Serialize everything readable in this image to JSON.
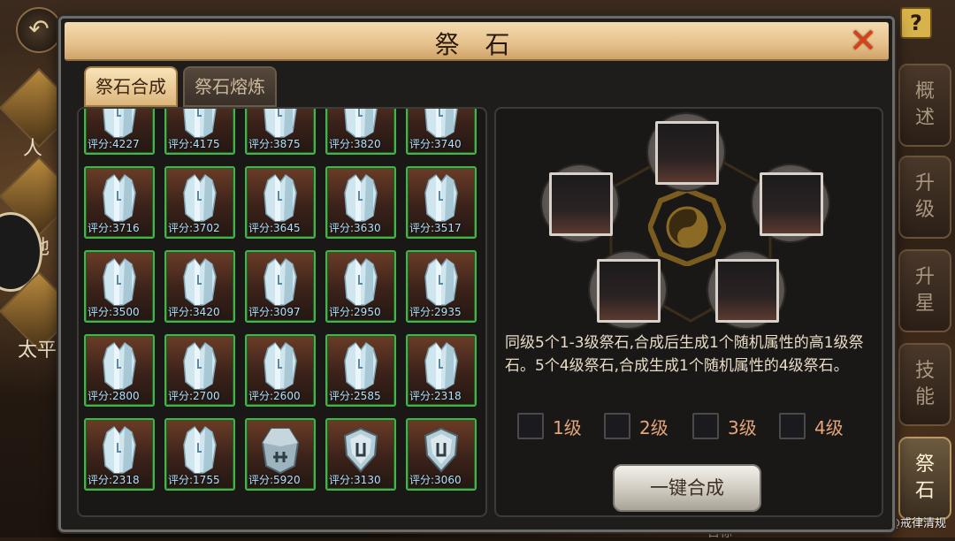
{
  "dialog": {
    "title": "祭 石",
    "close_symbol": "✕",
    "tabs": [
      {
        "label": "祭石合成",
        "active": true
      },
      {
        "label": "祭石熔炼",
        "active": false
      }
    ]
  },
  "inventory": {
    "rows": [
      [
        {
          "score": "评分:4227",
          "type": "crystal"
        },
        {
          "score": "评分:4175",
          "type": "crystal"
        },
        {
          "score": "评分:3875",
          "type": "crystal"
        },
        {
          "score": "评分:3820",
          "type": "crystal"
        },
        {
          "score": "评分:3740",
          "type": "crystal"
        }
      ],
      [
        {
          "score": "评分:3716",
          "type": "crystal"
        },
        {
          "score": "评分:3702",
          "type": "crystal"
        },
        {
          "score": "评分:3645",
          "type": "crystal"
        },
        {
          "score": "评分:3630",
          "type": "crystal"
        },
        {
          "score": "评分:3517",
          "type": "crystal"
        }
      ],
      [
        {
          "score": "评分:3500",
          "type": "crystal"
        },
        {
          "score": "评分:3420",
          "type": "crystal"
        },
        {
          "score": "评分:3097",
          "type": "crystal"
        },
        {
          "score": "评分:2950",
          "type": "crystal"
        },
        {
          "score": "评分:2935",
          "type": "crystal"
        }
      ],
      [
        {
          "score": "评分:2800",
          "type": "crystal"
        },
        {
          "score": "评分:2700",
          "type": "crystal"
        },
        {
          "score": "评分:2600",
          "type": "crystal"
        },
        {
          "score": "评分:2585",
          "type": "crystal"
        },
        {
          "score": "评分:2318",
          "type": "crystal"
        }
      ],
      [
        {
          "score": "评分:2318",
          "type": "crystal"
        },
        {
          "score": "评分:1755",
          "type": "crystal"
        },
        {
          "score": "评分:5920",
          "type": "stone"
        },
        {
          "score": "评分:3130",
          "type": "shield"
        },
        {
          "score": "评分:3060",
          "type": "shield"
        }
      ]
    ]
  },
  "synthesis": {
    "description": "同级5个1-3级祭石,合成后生成1个随机属性的高1级祭石。5个4级祭石,合成生成1个随机属性的4级祭石。",
    "levels": [
      "1级",
      "2级",
      "3级",
      "4级"
    ],
    "merge_button": "一键合成"
  },
  "side_tabs": [
    {
      "label": "概\n述",
      "active": false
    },
    {
      "label": "升\n级",
      "active": false
    },
    {
      "label": "升\n星",
      "active": false
    },
    {
      "label": "技\n能",
      "active": false
    },
    {
      "label": "祭\n石",
      "active": true
    }
  ],
  "background": {
    "left_labels": [
      "人",
      "地",
      "太平"
    ],
    "help_symbol": "?",
    "back_symbol": "↶",
    "bottom_text": "目标",
    "watermark": "@戒律清规"
  }
}
